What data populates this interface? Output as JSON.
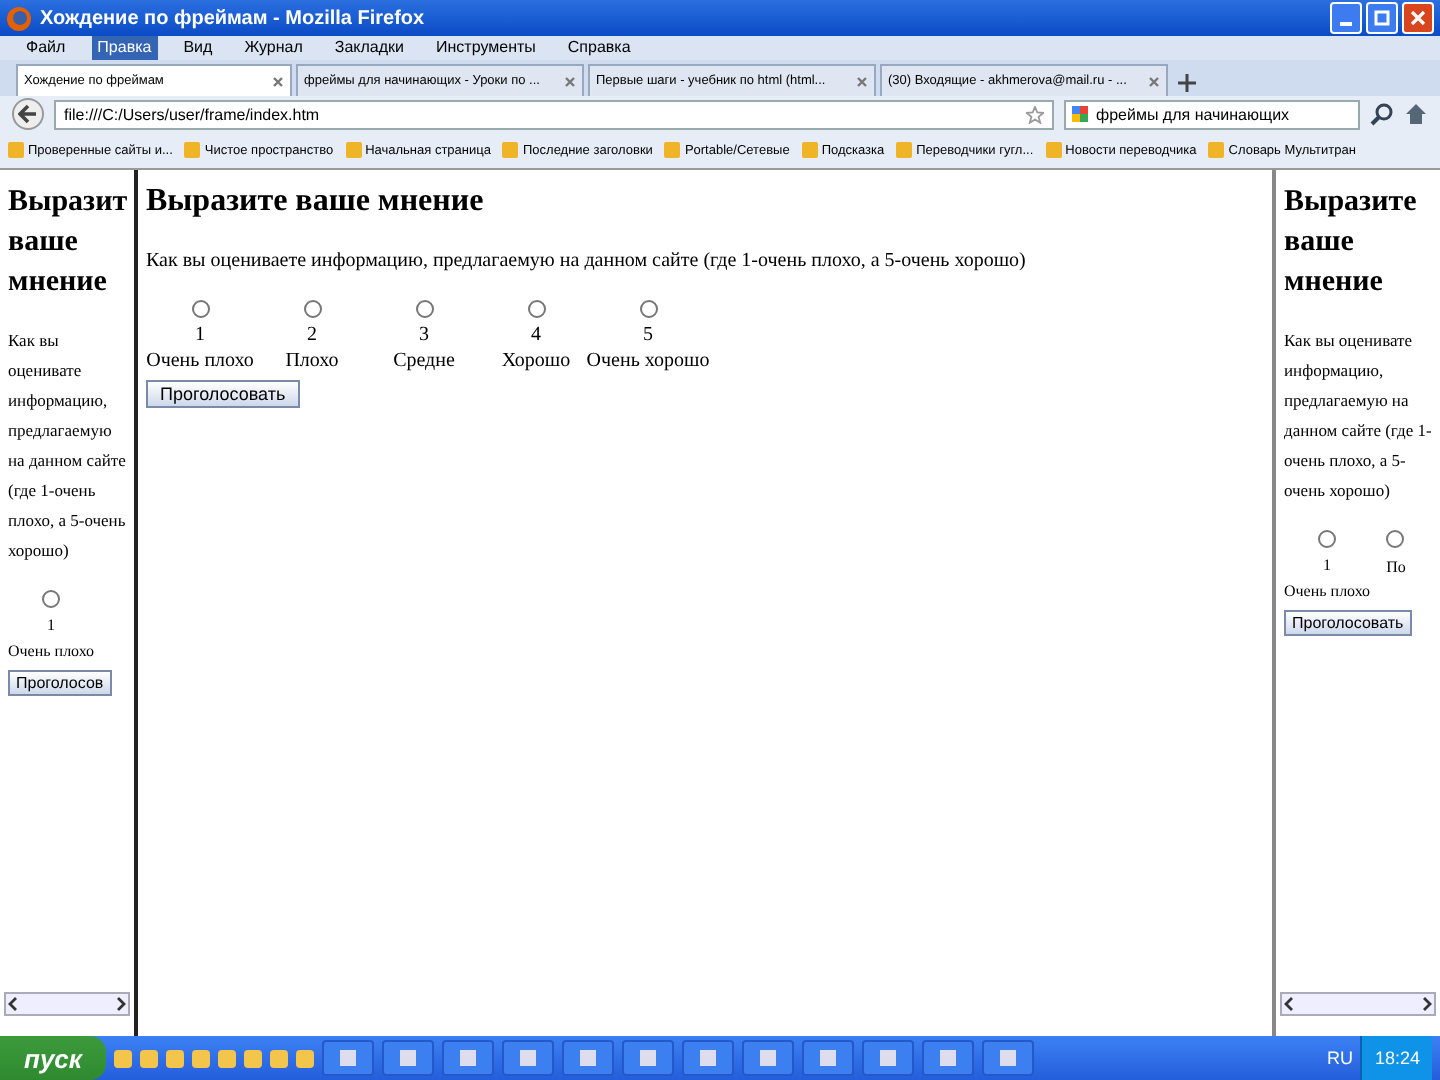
{
  "window": {
    "title": "Хождение по фреймам - Mozilla Firefox"
  },
  "menu": [
    {
      "label": "Файл",
      "selected": false
    },
    {
      "label": "Правка",
      "selected": true
    },
    {
      "label": "Вид",
      "selected": false
    },
    {
      "label": "Журнал",
      "selected": false
    },
    {
      "label": "Закладки",
      "selected": false
    },
    {
      "label": "Инструменты",
      "selected": false
    },
    {
      "label": "Справка",
      "selected": false
    }
  ],
  "tabs": [
    {
      "label": "Хождение по фреймам",
      "selected": true
    },
    {
      "label": "фреймы для начинающих - Уроки по ...",
      "selected": false
    },
    {
      "label": "Первые шаги - учебник по html (html...",
      "selected": false
    },
    {
      "label": "(30) Входящие - akhmerova@mail.ru - ...",
      "selected": false
    }
  ],
  "address": {
    "value": "file:///C:/Users/user/frame/index.htm"
  },
  "search": {
    "value": "фреймы для начинающих"
  },
  "bookmarks": [
    "Проверенные сайты и...",
    "Чистое пространство",
    "Начальная страница",
    "Последние заголовки",
    "Portable/Сетевые",
    "Подсказка",
    "Переводчики гугл...",
    "Новости переводчика",
    "Словарь Мультитран"
  ],
  "frames": [
    {
      "kind": "side",
      "heading": "Выразит ваше мнение",
      "question": "Как вы оценивате информацию, предлагаемую на данном сайте (где 1-очень плохо, а 5-очень хорошо)",
      "options": [
        {
          "number": "1",
          "label": "Очень плохо",
          "selected": false
        }
      ],
      "button": "Проголосов"
    },
    {
      "kind": "main",
      "heading": "Выразите ваше мнение",
      "question": "Как вы оцениваете информацию, предлагаемую на данном сайте (где 1-очень плохо, а 5-очень хорошо)",
      "options": [
        {
          "number": "1",
          "label": "Очень плохо",
          "selected": false
        },
        {
          "number": "2",
          "label": "Плохо",
          "selected": false
        },
        {
          "number": "3",
          "label": "Средне",
          "selected": false
        },
        {
          "number": "4",
          "label": "Хорошо",
          "selected": false
        },
        {
          "number": "5",
          "label": "Очень хорошо",
          "selected": false
        }
      ],
      "button": "Проголосовать"
    },
    {
      "kind": "side",
      "heading": "Выразите ваше мнение",
      "question": "Как вы оценивате информацию, предлагаемую на данном сайте (где 1-очень плохо, а 5-очень хорошо)",
      "options": [
        {
          "number": "1",
          "label": "Очень плохо",
          "selected": false
        },
        {
          "label": "По",
          "selected": false
        }
      ],
      "button": "Проголосовать"
    }
  ],
  "taskbar": {
    "start": "пуск",
    "language": "RU",
    "clock": "18:24"
  }
}
